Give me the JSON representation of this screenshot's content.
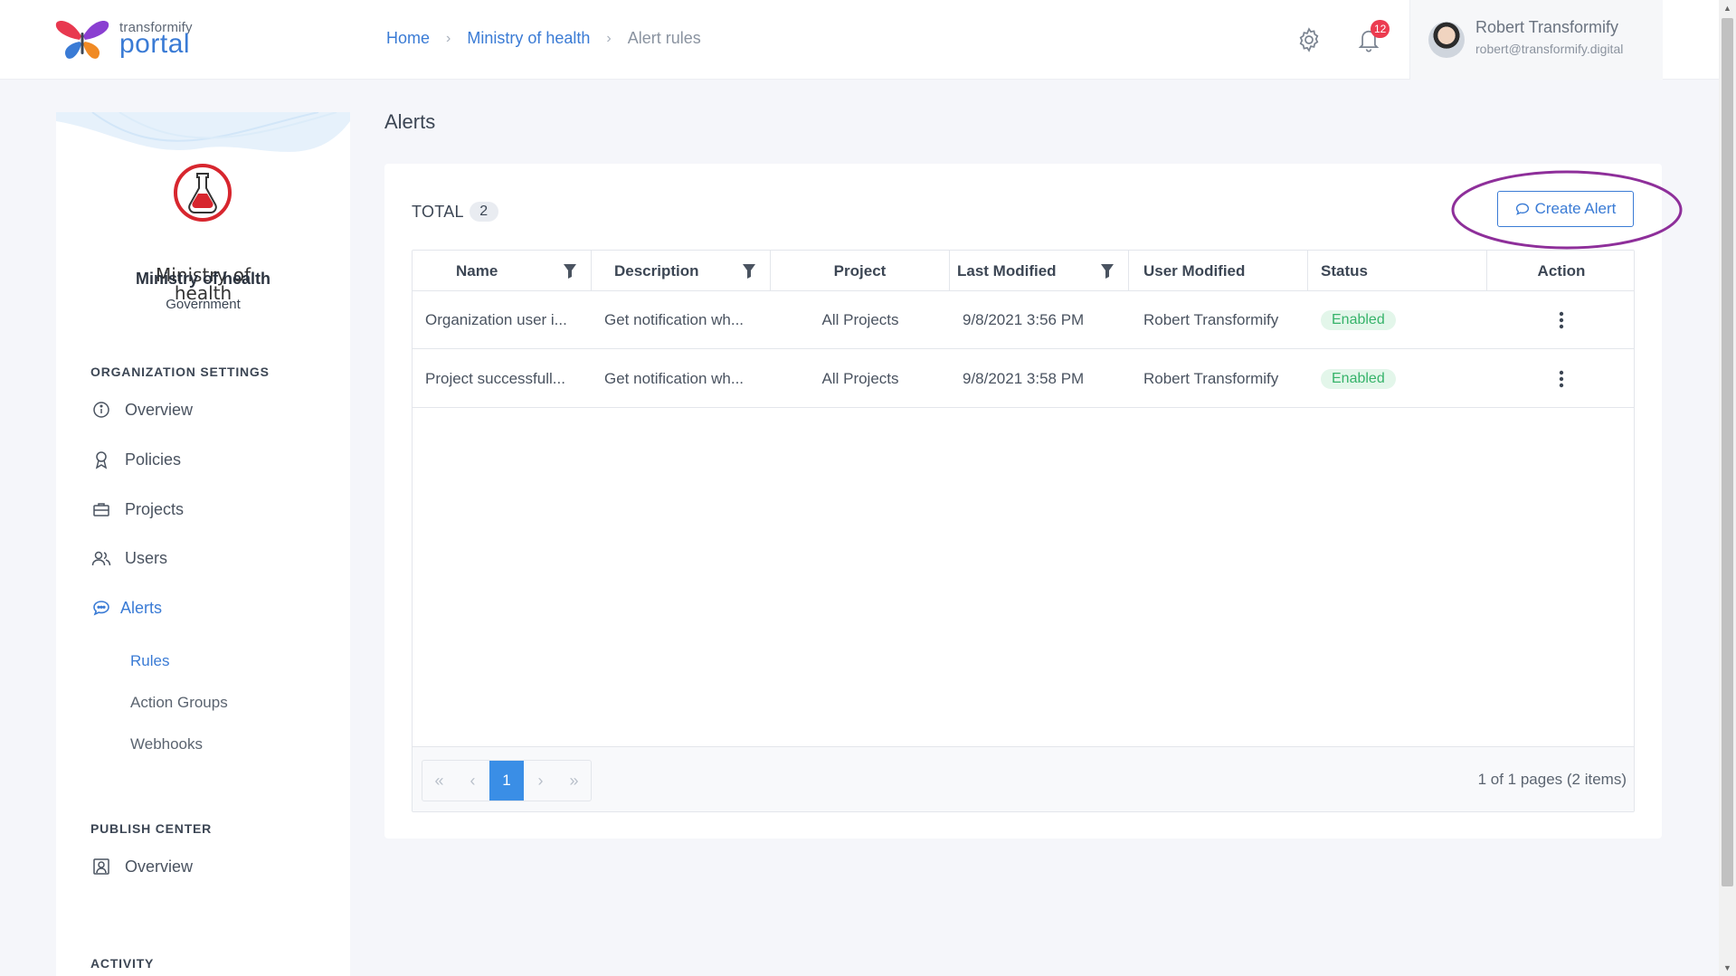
{
  "brand": {
    "small": "transformify",
    "big": "portal"
  },
  "breadcrumb": {
    "home": "Home",
    "org": "Ministry of health",
    "current": "Alert rules",
    "sep": "›"
  },
  "header": {
    "notifications_count": "12"
  },
  "user": {
    "name": "Robert Transformify",
    "email": "robert@transformify.digital"
  },
  "sidebar": {
    "org_logo_text_1": "Ministry of",
    "org_logo_text_2": "health",
    "org_name": "Ministry of health",
    "org_type": "Government",
    "sections": {
      "org_settings": "ORGANIZATION SETTINGS",
      "publish_center": "PUBLISH CENTER",
      "activity": "ACTIVITY"
    },
    "items": {
      "overview": "Overview",
      "policies": "Policies",
      "projects": "Projects",
      "users": "Users",
      "alerts": "Alerts",
      "rules": "Rules",
      "action_groups": "Action Groups",
      "webhooks": "Webhooks",
      "publish_overview": "Overview"
    }
  },
  "main": {
    "title": "Alerts",
    "total_label": "TOTAL",
    "total_count": "2",
    "create_label": "Create Alert",
    "columns": [
      "Name",
      "Description",
      "Project",
      "Last Modified",
      "User Modified",
      "Status",
      "Action"
    ],
    "rows": [
      {
        "name": "Organization user i...",
        "description": "Get notification wh...",
        "project": "All Projects",
        "last_modified": "9/8/2021 3:56 PM",
        "user_modified": "Robert Transformify",
        "status": "Enabled"
      },
      {
        "name": "Project successfull...",
        "description": "Get notification wh...",
        "project": "All Projects",
        "last_modified": "9/8/2021 3:58 PM",
        "user_modified": "Robert Transformify",
        "status": "Enabled"
      }
    ],
    "pager": {
      "current_page": "1",
      "info": "1 of 1 pages (2 items)"
    }
  },
  "colors": {
    "accent": "#3a7bd5",
    "enabled_text": "#36b36a",
    "enabled_bg": "#e3f6ea",
    "highlight": "#8e2f9a",
    "badge": "#ec3b50"
  },
  "icons": [
    "settings-gear-icon",
    "bell-icon",
    "info-icon",
    "location-pin-icon",
    "briefcase-icon",
    "users-icon",
    "chat-bubble-icon",
    "filter-icon",
    "kebab-menu-icon",
    "portrait-icon"
  ]
}
